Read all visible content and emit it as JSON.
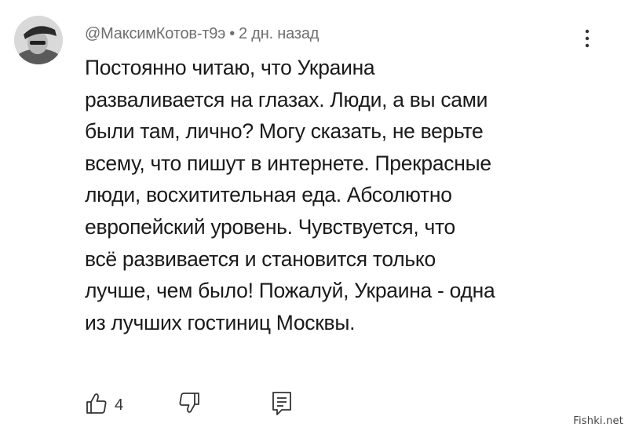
{
  "comment": {
    "author": "@МаксимКотов-т9э",
    "separator": "•",
    "time": "2 дн. назад",
    "lines": [
      "Постоянно читаю, что Украина",
      "разваливается на глазах. Люди, а вы сами",
      "были там, лично? Могу сказать, не верьте",
      "всему, что пишут в интернете. Прекрасные",
      "люди, восхитительная еда. Абсолютно",
      "европейский уровень. Чувствуется, что",
      "всё развивается и становится только",
      "лучше, чем было! Пожалуй, Украина - одна",
      "из лучших гостиниц Москвы."
    ]
  },
  "actions": {
    "like_icon": "thumbs-up-icon",
    "like_count": "4",
    "dislike_icon": "thumbs-down-icon",
    "reply_icon": "reply-icon",
    "menu_icon": "more-vertical-icon"
  },
  "watermark": {
    "text": "Fishki.net"
  }
}
